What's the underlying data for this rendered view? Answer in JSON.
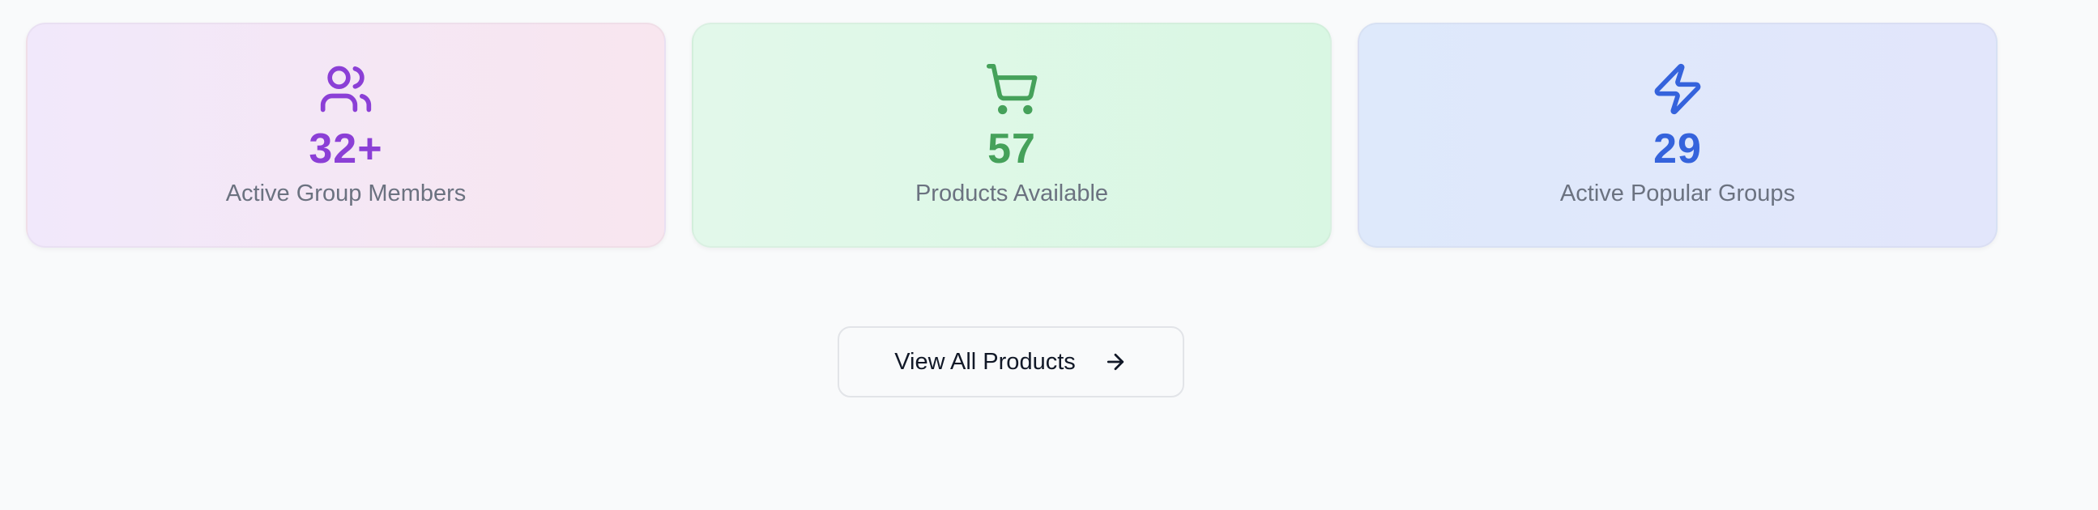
{
  "stats": [
    {
      "icon": "users-icon",
      "value": "32+",
      "label": "Active Group Members",
      "color": "#8b3fd6"
    },
    {
      "icon": "shopping-cart-icon",
      "value": "57",
      "label": "Products Available",
      "color": "#45a15a"
    },
    {
      "icon": "lightning-bolt-icon",
      "value": "29",
      "label": "Active Popular Groups",
      "color": "#3563dc"
    }
  ],
  "actions": {
    "view_all_label": "View All Products",
    "view_all_icon": "arrow-right-icon"
  }
}
